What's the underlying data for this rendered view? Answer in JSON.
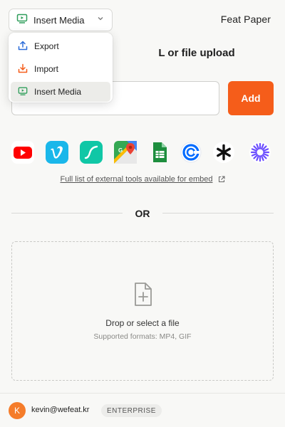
{
  "header": {
    "mode_select": {
      "label": "Insert Media",
      "icon": "media-monitor-icon"
    },
    "brand": "Feat Paper"
  },
  "menu": {
    "items": [
      {
        "label": "Export",
        "icon": "export-upload-icon",
        "color": "#2b6cd9",
        "selected": false
      },
      {
        "label": "Import",
        "icon": "import-download-icon",
        "color": "#f55d1a",
        "selected": false
      },
      {
        "label": "Insert Media",
        "icon": "media-monitor-icon",
        "color": "#2f9e5a",
        "selected": true
      }
    ]
  },
  "main": {
    "section_title_visible": "L or file upload",
    "url_input": {
      "value": "",
      "placeholder": ""
    },
    "add_label": "Add",
    "tools": [
      {
        "name": "youtube",
        "icon": "youtube-icon",
        "color": "#ff0000"
      },
      {
        "name": "vimeo",
        "icon": "vimeo-icon",
        "color": "#1ab7ea"
      },
      {
        "name": "slides",
        "icon": "slides-icon",
        "color": "#10c7a6"
      },
      {
        "name": "maps",
        "icon": "google-maps-icon",
        "color": "#34a853"
      },
      {
        "name": "sheets",
        "icon": "google-sheets-icon",
        "color": "#1e8e3e"
      },
      {
        "name": "calendly",
        "icon": "calendly-icon",
        "color": "#006bff"
      },
      {
        "name": "asterisk",
        "icon": "asterisk-icon",
        "color": "#111111"
      },
      {
        "name": "burst",
        "icon": "burst-icon",
        "color": "#6b4dff"
      }
    ],
    "tools_link": "Full list of external tools available for embed",
    "or_label": "OR",
    "dropzone": {
      "title": "Drop or select a file",
      "subtitle": "Supported formats: MP4, GIF"
    }
  },
  "footer": {
    "avatar_initial": "K",
    "email": "kevin@wefeat.kr",
    "plan": "ENTERPRISE"
  },
  "colors": {
    "accent": "#f55d1a",
    "background": "#f8f8f6",
    "border": "#d9d9d6"
  }
}
